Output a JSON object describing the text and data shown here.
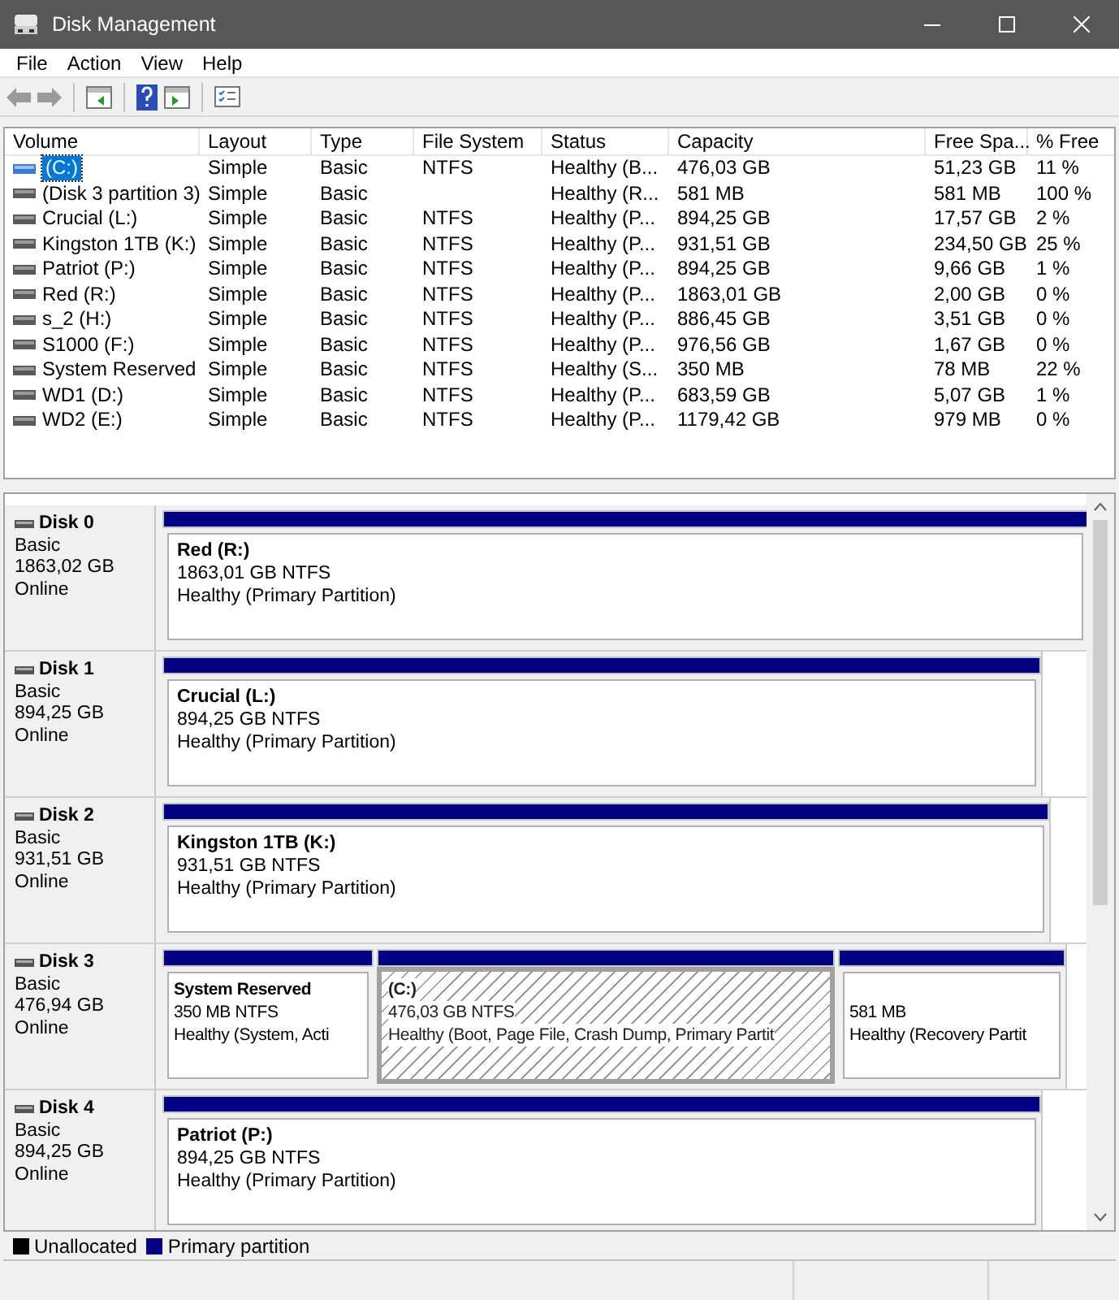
{
  "window": {
    "title": "Disk Management"
  },
  "menu": [
    "File",
    "Action",
    "View",
    "Help"
  ],
  "table": {
    "columns": [
      "Volume",
      "Layout",
      "Type",
      "File System",
      "Status",
      "Capacity",
      "Free Spa...",
      "% Free"
    ],
    "rows": [
      {
        "selected": true,
        "cells": [
          "(C:)",
          "Simple",
          "Basic",
          "NTFS",
          "Healthy (B...",
          "476,03 GB",
          "51,23 GB",
          "11 %"
        ]
      },
      {
        "selected": false,
        "cells": [
          "(Disk 3 partition 3)",
          "Simple",
          "Basic",
          "",
          "Healthy (R...",
          "581 MB",
          "581 MB",
          "100 %"
        ]
      },
      {
        "selected": false,
        "cells": [
          "Crucial (L:)",
          "Simple",
          "Basic",
          "NTFS",
          "Healthy (P...",
          "894,25 GB",
          "17,57 GB",
          "2 %"
        ]
      },
      {
        "selected": false,
        "cells": [
          "Kingston 1TB (K:)",
          "Simple",
          "Basic",
          "NTFS",
          "Healthy (P...",
          "931,51 GB",
          "234,50 GB",
          "25 %"
        ]
      },
      {
        "selected": false,
        "cells": [
          "Patriot (P:)",
          "Simple",
          "Basic",
          "NTFS",
          "Healthy (P...",
          "894,25 GB",
          "9,66 GB",
          "1 %"
        ]
      },
      {
        "selected": false,
        "cells": [
          "Red (R:)",
          "Simple",
          "Basic",
          "NTFS",
          "Healthy (P...",
          "1863,01 GB",
          "2,00 GB",
          "0 %"
        ]
      },
      {
        "selected": false,
        "cells": [
          "s_2 (H:)",
          "Simple",
          "Basic",
          "NTFS",
          "Healthy (P...",
          "886,45 GB",
          "3,51 GB",
          "0 %"
        ]
      },
      {
        "selected": false,
        "cells": [
          "S1000 (F:)",
          "Simple",
          "Basic",
          "NTFS",
          "Healthy (P...",
          "976,56 GB",
          "1,67 GB",
          "0 %"
        ]
      },
      {
        "selected": false,
        "cells": [
          "System Reserved",
          "Simple",
          "Basic",
          "NTFS",
          "Healthy (S...",
          "350 MB",
          "78 MB",
          "22 %"
        ]
      },
      {
        "selected": false,
        "cells": [
          "WD1 (D:)",
          "Simple",
          "Basic",
          "NTFS",
          "Healthy (P...",
          "683,59 GB",
          "5,07 GB",
          "1 %"
        ]
      },
      {
        "selected": false,
        "cells": [
          "WD2 (E:)",
          "Simple",
          "Basic",
          "NTFS",
          "Healthy (P...",
          "1179,42 GB",
          "979 MB",
          "0 %"
        ]
      }
    ]
  },
  "disks": [
    {
      "name": "Disk 0",
      "type": "Basic",
      "size": "1863,02 GB",
      "status": "Online",
      "partitions": [
        {
          "name": "Red  (R:)",
          "size": "1863,01 GB NTFS",
          "status": "Healthy (Primary Partition)",
          "selected": false
        }
      ]
    },
    {
      "name": "Disk 1",
      "type": "Basic",
      "size": "894,25 GB",
      "status": "Online",
      "partitions": [
        {
          "name": "Crucial  (L:)",
          "size": "894,25 GB NTFS",
          "status": "Healthy (Primary Partition)",
          "selected": false
        }
      ]
    },
    {
      "name": "Disk 2",
      "type": "Basic",
      "size": "931,51 GB",
      "status": "Online",
      "partitions": [
        {
          "name": "Kingston 1TB  (K:)",
          "size": "931,51 GB NTFS",
          "status": "Healthy (Primary Partition)",
          "selected": false
        }
      ]
    },
    {
      "name": "Disk 3",
      "type": "Basic",
      "size": "476,94 GB",
      "status": "Online",
      "partitions": [
        {
          "name": "System Reserved",
          "size": "350 MB NTFS",
          "status": "Healthy (System, Acti",
          "selected": false
        },
        {
          "name": "(C:)",
          "size": "476,03 GB NTFS",
          "status": "Healthy (Boot, Page File, Crash Dump, Primary Partit",
          "selected": true
        },
        {
          "size": "581 MB",
          "status": "Healthy (Recovery Partit",
          "selected": false
        }
      ]
    },
    {
      "name": "Disk 4",
      "type": "Basic",
      "size": "894,25 GB",
      "status": "Online",
      "partitions": [
        {
          "name": "Patriot  (P:)",
          "size": "894,25 GB NTFS",
          "status": "Healthy (Primary Partition)",
          "selected": false
        }
      ]
    }
  ],
  "legend": [
    {
      "label": "Unallocated",
      "color": "#000000"
    },
    {
      "label": "Primary partition",
      "color": "#000080"
    }
  ]
}
